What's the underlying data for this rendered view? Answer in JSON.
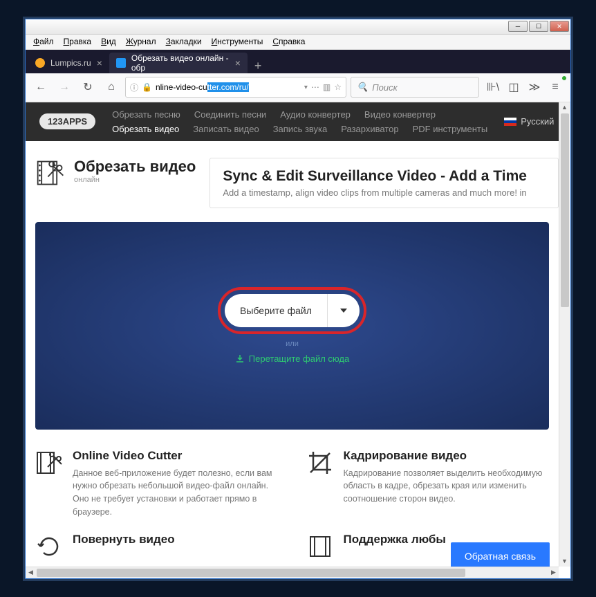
{
  "window": {
    "menu": [
      "Файл",
      "Правка",
      "Вид",
      "Журнал",
      "Закладки",
      "Инструменты",
      "Справка"
    ]
  },
  "tabs": {
    "items": [
      {
        "label": "Lumpics.ru",
        "active": false
      },
      {
        "label": "Обрезать видео онлайн - обр",
        "active": true
      }
    ]
  },
  "toolbar": {
    "url_prefix": "nline-video-cu",
    "url_selected": "tter.com/ru/",
    "search_placeholder": "Поиск"
  },
  "nav": {
    "logo": "123APPS",
    "row1": [
      "Обрезать песню",
      "Соединить песни",
      "Аудио конвертер",
      "Видео конвертер"
    ],
    "row2": [
      "Обрезать видео",
      "Записать видео",
      "Запись звука",
      "Разархиватор",
      "PDF инструменты"
    ],
    "active": "Обрезать видео",
    "lang": "Русский"
  },
  "page": {
    "title": "Обрезать видео",
    "subtitle": "онлайн",
    "ad_title": "Sync & Edit Surveillance Video - Add a Time",
    "ad_text": "Add a timestamp, align video clips from multiple cameras and much more! in"
  },
  "upload": {
    "button": "Выберите файл",
    "or": "или",
    "drag": "Перетащите файл сюда"
  },
  "features": [
    {
      "title": "Online Video Cutter",
      "text": "Данное веб-приложение будет полезно, если вам нужно обрезать небольшой видео-файл онлайн. Оно не требует установки и работает прямо в браузере."
    },
    {
      "title": "Кадрирование видео",
      "text": "Кадрирование позволяет выделить необходимую область в кадре, обрезать края или изменить соотношение сторон видео."
    },
    {
      "title": "Повернуть видео",
      "text": ""
    },
    {
      "title": "Поддержка любы",
      "text": ""
    }
  ],
  "feedback": "Обратная связь"
}
